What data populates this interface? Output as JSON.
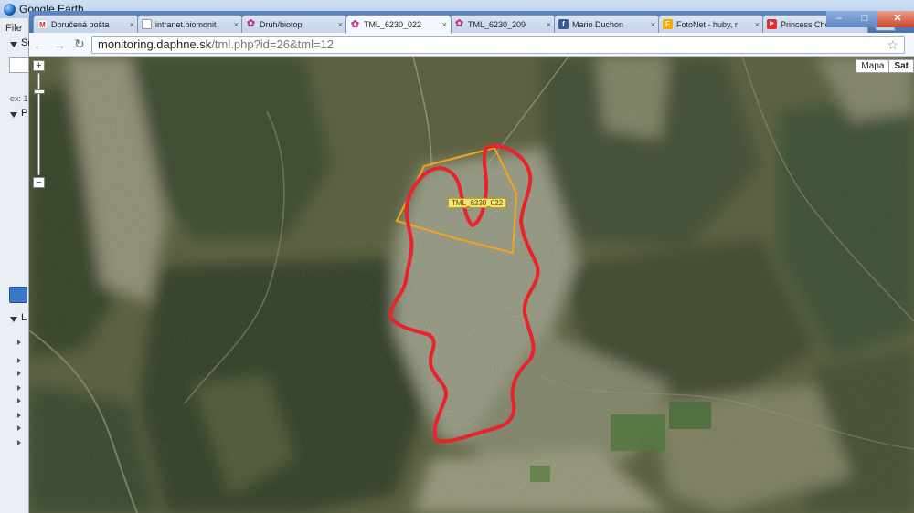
{
  "earth": {
    "title": "Google Earth",
    "menu_file": "File",
    "panel_search": "Se",
    "panel_places": "P",
    "panel_layers": "L",
    "search_hint": "ex: 1"
  },
  "tabs": [
    {
      "title": "Doručená pošta",
      "icon": "gmail-icon",
      "fav": "M",
      "active": false
    },
    {
      "title": "intranet.biomonit",
      "icon": "document-icon",
      "fav": "",
      "active": false
    },
    {
      "title": "Druh/biotop",
      "icon": "flower-icon",
      "fav": "✿",
      "active": false
    },
    {
      "title": "TML_6230_022",
      "icon": "flower-icon",
      "fav": "✿",
      "active": true
    },
    {
      "title": "TML_6230_209",
      "icon": "flower-icon",
      "fav": "✿",
      "active": false
    },
    {
      "title": "Mario Duchon",
      "icon": "facebook-icon",
      "fav": "f",
      "active": false
    },
    {
      "title": "FotoNet - huby, r",
      "icon": "fotonet-icon",
      "fav": "F",
      "active": false
    },
    {
      "title": "Princess Chelsea -",
      "icon": "youtube-icon",
      "fav": "▶",
      "active": false
    }
  ],
  "address": {
    "domain": "monitoring.daphne.sk",
    "path": "/tml.php?id=26&tml=12"
  },
  "map": {
    "type_map": "Mapa",
    "type_satellite": "Sat",
    "plot_label": "TML_6230_022",
    "zoom_level": 0.17,
    "colors": {
      "boundary": "#e8232a",
      "plot": "#f5a31a"
    }
  }
}
